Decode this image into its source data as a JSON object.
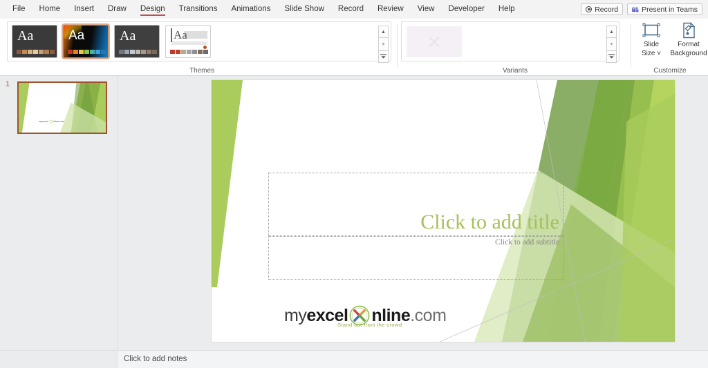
{
  "window": {
    "app": "PowerPoint",
    "active_tab": "Design"
  },
  "ribbon_tabs": [
    {
      "label": "File",
      "active": false
    },
    {
      "label": "Home",
      "active": false
    },
    {
      "label": "Insert",
      "active": false
    },
    {
      "label": "Draw",
      "active": false
    },
    {
      "label": "Design",
      "active": true
    },
    {
      "label": "Transitions",
      "active": false
    },
    {
      "label": "Animations",
      "active": false
    },
    {
      "label": "Slide Show",
      "active": false
    },
    {
      "label": "Record",
      "active": false
    },
    {
      "label": "Review",
      "active": false
    },
    {
      "label": "View",
      "active": false
    },
    {
      "label": "Developer",
      "active": false
    },
    {
      "label": "Help",
      "active": false
    }
  ],
  "tabbar_right": {
    "record_label": "Record",
    "record_icon": "record-dot-icon",
    "present_label": "Present in Teams",
    "present_icon": "teams-icon"
  },
  "ribbon_groups": {
    "themes": {
      "label": "Themes",
      "thumbnails": [
        {
          "name": "theme-office-dark",
          "sample_text": "Aa",
          "selected": false,
          "swatches": [
            "#8c5a3c",
            "#c08a5a",
            "#d8b288",
            "#e8c9a0",
            "#c9a079",
            "#b07f53",
            "#8a5e3b"
          ]
        },
        {
          "name": "theme-berlin-black",
          "sample_text": "Aa",
          "selected": true,
          "swatches": [
            "#c0392b",
            "#e67e22",
            "#e8c547",
            "#8bc34a",
            "#4caf9f",
            "#3aa0d8",
            "#2176b8"
          ]
        },
        {
          "name": "theme-slate-grey",
          "sample_text": "Aa",
          "selected": false,
          "swatches": [
            "#6c7a89",
            "#9aa7b1",
            "#c3cad0",
            "#b9bcae",
            "#a89a87",
            "#8d7d6b",
            "#7a6a58"
          ]
        },
        {
          "name": "theme-light-minimal",
          "sample_text": "Aa",
          "selected": false,
          "swatches": [
            "#c0392b",
            "#b5452f",
            "#b9a98f",
            "#a3a3a3",
            "#8f8f8f",
            "#7a6e62",
            "#6b6b6b"
          ]
        }
      ],
      "scroll_up": "scroll-up-arrow",
      "scroll_down": "scroll-down-arrow",
      "more": "more-themes-dropdown"
    },
    "variants": {
      "label": "Variants",
      "thumbnails": [
        {
          "name": "variant-1",
          "selected": false
        }
      ],
      "scroll_up": "scroll-up-arrow",
      "scroll_down": "scroll-down-arrow",
      "more": "more-variants-dropdown"
    },
    "customize": {
      "label": "Customize",
      "buttons": [
        {
          "name": "slide-size-button",
          "label_line1": "Slide",
          "label_line2": "Size ˅",
          "icon": "slide-size-icon"
        },
        {
          "name": "format-background-button",
          "label_line1": "Format",
          "label_line2": "Background",
          "icon": "format-background-icon"
        }
      ]
    }
  },
  "thumbnail_pane": {
    "slides": [
      {
        "number": "1",
        "selected": true
      }
    ]
  },
  "slide": {
    "title_placeholder": "Click to add title",
    "subtitle_placeholder": "Click to add subtitle",
    "logo": {
      "part_my": "my",
      "part_excel": "excel",
      "part_nline": "nline",
      "part_com": ".com",
      "emblem": "x-circle-logo-icon",
      "tagline": "Stand out from the crowd"
    },
    "theme_colors": {
      "light_green": "#a9cc5c",
      "mid_green": "#8ab34a",
      "dark_green": "#6d9a3f",
      "pale_green": "#d8e8b8",
      "title_green": "#a6bf5a"
    }
  },
  "notes": {
    "placeholder": "Click to add notes"
  }
}
